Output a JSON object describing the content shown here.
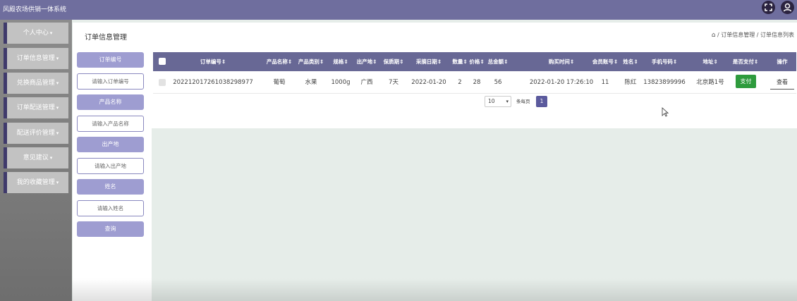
{
  "app": {
    "title": "风殿农场供销一体系统"
  },
  "header_icons": [
    "fullscreen-icon",
    "user-icon"
  ],
  "sidebar": {
    "items": [
      {
        "label": "个人中心"
      },
      {
        "label": "订单信息管理"
      },
      {
        "label": "兑换商品管理"
      },
      {
        "label": "订单配送管理"
      },
      {
        "label": "配送评价管理"
      },
      {
        "label": "意见建议"
      },
      {
        "label": "我的收藏管理"
      }
    ]
  },
  "page": {
    "title": "订单信息管理",
    "breadcrumb": [
      "订单信息管理",
      "订单信息列表"
    ],
    "breadcrumb_sep": "/"
  },
  "filters": {
    "order_no": {
      "label": "订单编号",
      "placeholder": "请输入订单编号"
    },
    "product_name": {
      "label": "产品名称",
      "placeholder": "请输入产品名称"
    },
    "origin": {
      "label": "出产地",
      "placeholder": "请输入出产地"
    },
    "name": {
      "label": "姓名",
      "placeholder": "请输入姓名"
    },
    "search_label": "查询"
  },
  "table": {
    "columns": [
      "订单编号⇕",
      "产品名称⇕",
      "产品类别⇕",
      "规格⇕",
      "出产地⇕",
      "保质期⇕",
      "采摘日期⇕",
      "数量⇕",
      "价格⇕",
      "总金额⇕",
      "购买时间⇕",
      "会员账号⇕",
      "姓名⇕",
      "手机号码⇕",
      "地址⇕",
      "是否支付⇕",
      "操作"
    ],
    "rows": [
      {
        "cells": [
          "20221201726103829897​7",
          "葡萄",
          "水果",
          "1000g",
          "广西",
          "7天",
          "2022-01-20",
          "2",
          "28",
          "56",
          "2022-01-20 17:26:10",
          "11",
          "陈红",
          "13823899996",
          "北京路1号"
        ],
        "pay_label": "支付",
        "view_label": "查看"
      }
    ]
  },
  "pagination": {
    "page_size": "10",
    "per_page_label": "条每页",
    "current_page": "1"
  }
}
